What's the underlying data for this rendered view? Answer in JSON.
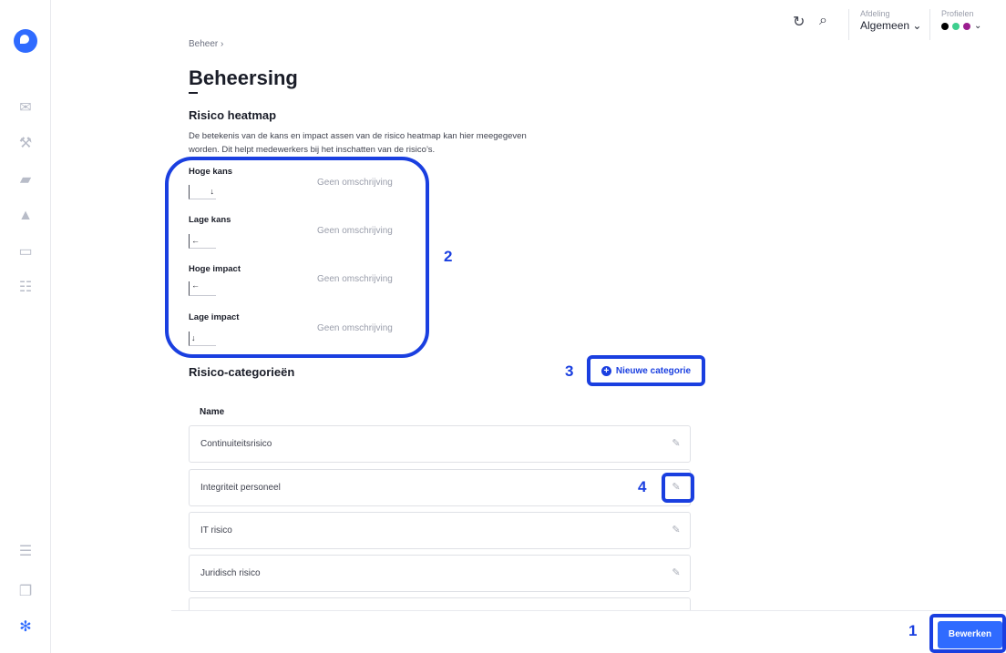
{
  "nav": {
    "items": [
      {
        "icon": "mail-icon",
        "glyph": "✉"
      },
      {
        "icon": "gavel-icon",
        "glyph": "⚒"
      },
      {
        "icon": "folder-icon",
        "glyph": "▰"
      },
      {
        "icon": "warning-icon",
        "glyph": "▲"
      },
      {
        "icon": "calendar-icon",
        "glyph": "▭"
      },
      {
        "icon": "checklist-icon",
        "glyph": "☷"
      }
    ],
    "bottom": [
      {
        "icon": "document-icon",
        "glyph": "☰"
      },
      {
        "icon": "copy-icon",
        "glyph": "❐"
      },
      {
        "icon": "settings-icon",
        "glyph": "✻"
      }
    ]
  },
  "topbar": {
    "refresh_icon": "↻",
    "search_icon": "⌕",
    "department_label": "Afdeling",
    "department_value": "Algemeen ⌄",
    "profiles_label": "Profielen",
    "profile_colors": [
      "#000000",
      "#3ecf8e",
      "#9b1d8f"
    ],
    "profiles_chevron": "⌄"
  },
  "breadcrumb": "Beheer  ›",
  "page_title": "Beheersing",
  "heatmap": {
    "title": "Risico heatmap",
    "description": "De betekenis van de kans en impact assen van de risico heatmap kan hier meegegeven worden. Dit helpt medewerkers bij het inschatten van de risico’s.",
    "items": [
      {
        "label": "Hoge kans",
        "description": "Geen omschrijving",
        "arrow": "↓"
      },
      {
        "label": "Lage kans",
        "description": "Geen omschrijving",
        "arrow": "←"
      },
      {
        "label": "Hoge impact",
        "description": "Geen omschrijving",
        "arrow": "←"
      },
      {
        "label": "Lage impact",
        "description": "Geen omschrijving",
        "arrow": "↓"
      }
    ]
  },
  "categories": {
    "title": "Risico-categorieën",
    "new_button": "Nieuwe categorie",
    "column_header": "Name",
    "rows": [
      "Continuiteitsrisico",
      "Integriteit personeel",
      "IT risico",
      "Juridisch risico"
    ]
  },
  "footer": {
    "save_button": "Bewerken"
  },
  "annotations": {
    "n1": "1",
    "n2": "2",
    "n3": "3",
    "n4": "4"
  },
  "colors": {
    "accent": "#2f6bff",
    "annotation": "#1a3fe0"
  }
}
